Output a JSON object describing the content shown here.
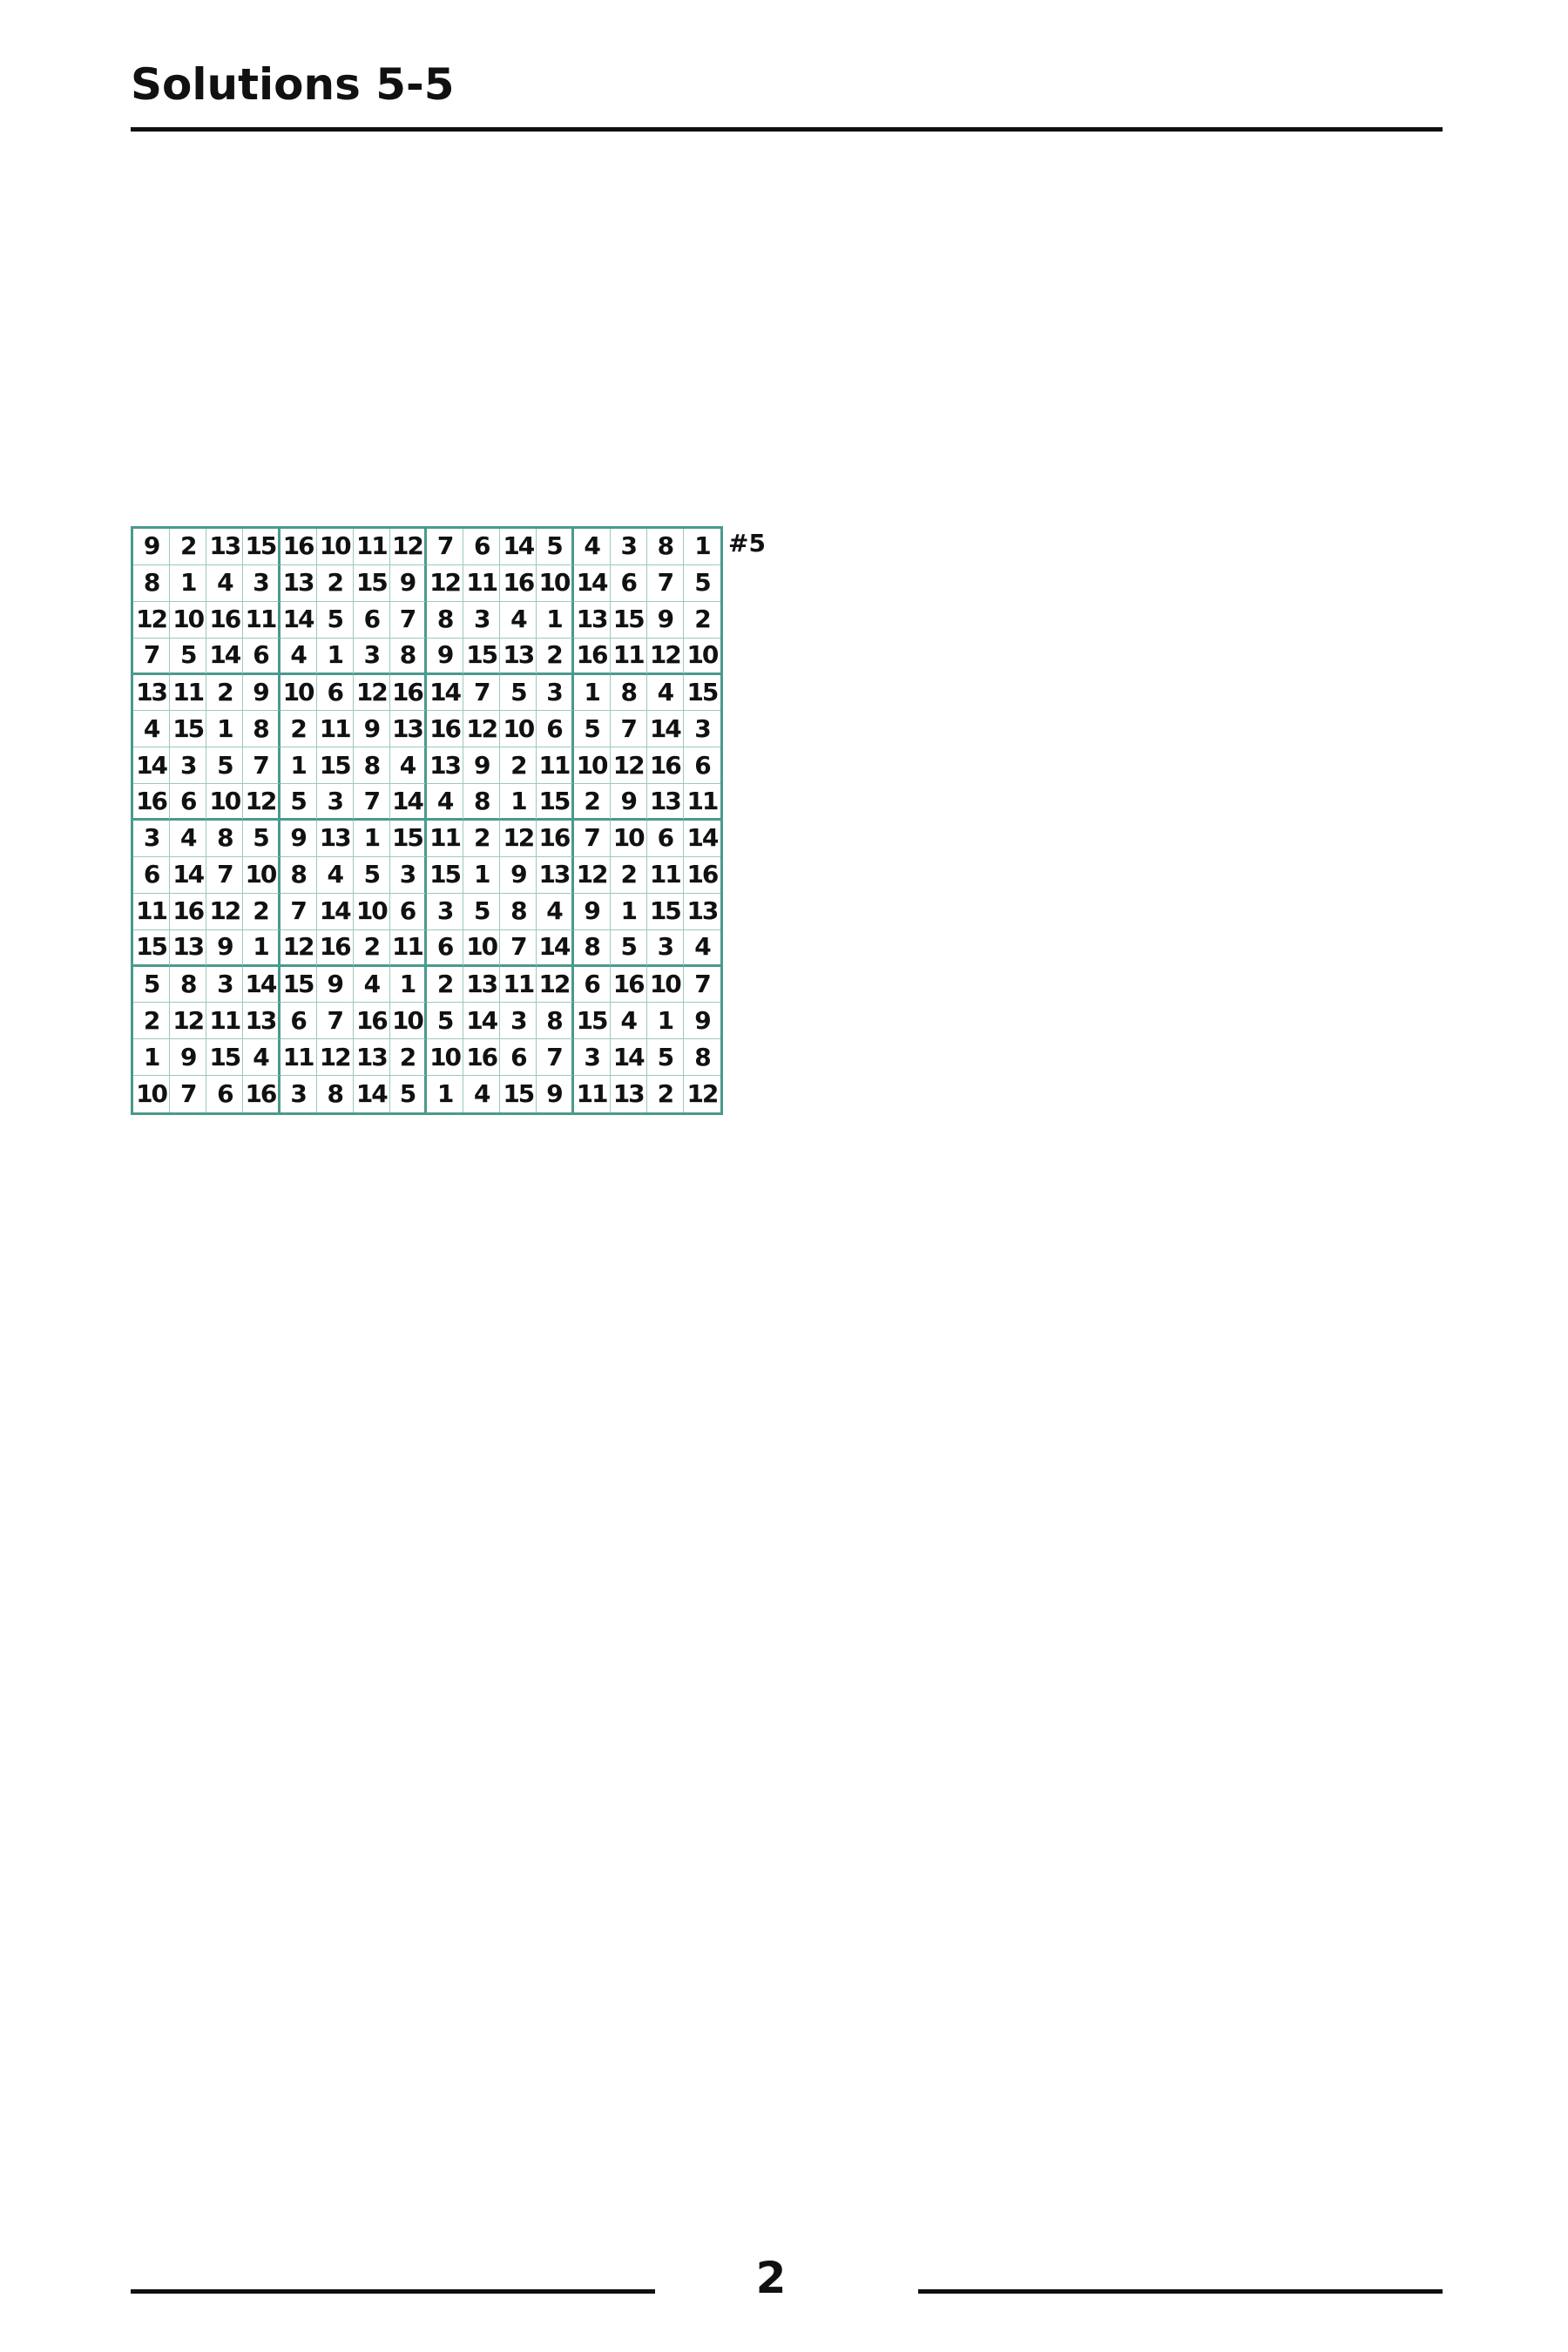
{
  "page": {
    "title": "Solutions 5-5",
    "page_number": "2"
  },
  "puzzle": {
    "label": "#5",
    "grid_color": "#4a9a8c",
    "rows": [
      [
        "9",
        "2",
        "13",
        "15",
        "16",
        "10",
        "11",
        "12",
        "7",
        "6",
        "14",
        "5",
        "4",
        "3",
        "8",
        "1"
      ],
      [
        "8",
        "1",
        "4",
        "3",
        "13",
        "2",
        "15",
        "9",
        "12",
        "11",
        "16",
        "10",
        "14",
        "6",
        "7",
        "5"
      ],
      [
        "12",
        "10",
        "16",
        "11",
        "14",
        "5",
        "6",
        "7",
        "8",
        "3",
        "4",
        "1",
        "13",
        "15",
        "9",
        "2"
      ],
      [
        "7",
        "5",
        "14",
        "6",
        "4",
        "1",
        "3",
        "8",
        "9",
        "15",
        "13",
        "2",
        "16",
        "11",
        "12",
        "10"
      ],
      [
        "13",
        "11",
        "2",
        "9",
        "10",
        "6",
        "12",
        "16",
        "14",
        "7",
        "5",
        "3",
        "1",
        "8",
        "4",
        "15"
      ],
      [
        "4",
        "15",
        "1",
        "8",
        "2",
        "11",
        "9",
        "13",
        "16",
        "12",
        "10",
        "6",
        "5",
        "7",
        "14",
        "3"
      ],
      [
        "14",
        "3",
        "5",
        "7",
        "1",
        "15",
        "8",
        "4",
        "13",
        "9",
        "2",
        "11",
        "10",
        "12",
        "16",
        "6"
      ],
      [
        "16",
        "6",
        "10",
        "12",
        "5",
        "3",
        "7",
        "14",
        "4",
        "8",
        "1",
        "15",
        "2",
        "9",
        "13",
        "11"
      ],
      [
        "3",
        "4",
        "8",
        "5",
        "9",
        "13",
        "1",
        "15",
        "11",
        "2",
        "12",
        "16",
        "7",
        "10",
        "6",
        "14"
      ],
      [
        "6",
        "14",
        "7",
        "10",
        "8",
        "4",
        "5",
        "3",
        "15",
        "1",
        "9",
        "13",
        "12",
        "2",
        "11",
        "16"
      ],
      [
        "11",
        "16",
        "12",
        "2",
        "7",
        "14",
        "10",
        "6",
        "3",
        "5",
        "8",
        "4",
        "9",
        "1",
        "15",
        "13"
      ],
      [
        "15",
        "13",
        "9",
        "1",
        "12",
        "16",
        "2",
        "11",
        "6",
        "10",
        "7",
        "14",
        "8",
        "5",
        "3",
        "4"
      ],
      [
        "5",
        "8",
        "3",
        "14",
        "15",
        "9",
        "4",
        "1",
        "2",
        "13",
        "11",
        "12",
        "6",
        "16",
        "10",
        "7"
      ],
      [
        "2",
        "12",
        "11",
        "13",
        "6",
        "7",
        "16",
        "10",
        "5",
        "14",
        "3",
        "8",
        "15",
        "4",
        "1",
        "9"
      ],
      [
        "1",
        "9",
        "15",
        "4",
        "11",
        "12",
        "13",
        "2",
        "10",
        "16",
        "6",
        "7",
        "3",
        "14",
        "5",
        "8"
      ],
      [
        "10",
        "7",
        "6",
        "16",
        "3",
        "8",
        "14",
        "5",
        "1",
        "4",
        "15",
        "9",
        "11",
        "13",
        "2",
        "12"
      ]
    ]
  }
}
